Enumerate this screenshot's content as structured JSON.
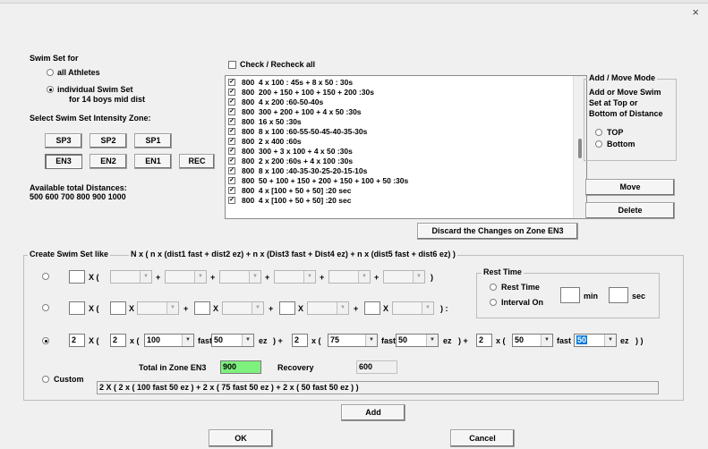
{
  "window": {
    "close_glyph": "×"
  },
  "swim_set_for": {
    "label": "Swim Set for",
    "opt_all": "all Athletes",
    "opt_individual_line1": "individual Swim Set",
    "opt_individual_line2": "for 14 boys mid dist",
    "selected": "individual"
  },
  "intensity": {
    "label": "Select Swim Set Intensity Zone:",
    "buttons": [
      "SP3",
      "SP2",
      "SP1",
      "EN3",
      "EN2",
      "EN1",
      "REC"
    ],
    "selected": "EN3"
  },
  "distances": {
    "label": "Available total Distances:",
    "values": "500 600 700 800 900 1000"
  },
  "check_all": {
    "label": "Check / Recheck all"
  },
  "sets": [
    {
      "dist": "800",
      "desc": "4 x 100 : 45s + 8 x 50 : 30s"
    },
    {
      "dist": "800",
      "desc": "200 + 150 + 100 + 150 + 200 :30s"
    },
    {
      "dist": "800",
      "desc": "4 x 200 :60-50-40s"
    },
    {
      "dist": "800",
      "desc": "300 + 200 + 100 + 4 x 50 :30s"
    },
    {
      "dist": "800",
      "desc": "16 x 50 :30s"
    },
    {
      "dist": "800",
      "desc": "8 x 100 :60-55-50-45-40-35-30s"
    },
    {
      "dist": "800",
      "desc": "2 x 400 :60s"
    },
    {
      "dist": "800",
      "desc": "300 + 3 x 100 + 4 x 50 :30s"
    },
    {
      "dist": "800",
      "desc": "2 x 200 :60s + 4 x 100 :30s"
    },
    {
      "dist": "800",
      "desc": "8 x 100 :40-35-30-25-20-15-10s"
    },
    {
      "dist": "800",
      "desc": "50 + 100 + 150 + 200 + 150 + 100 + 50 :30s"
    },
    {
      "dist": "800",
      "desc": "4 x [100 + 50 + 50] :20 sec"
    },
    {
      "dist": "800",
      "desc": "4 x [100 + 50 + 50] :20 sec"
    }
  ],
  "add_move": {
    "label": "Add / Move Mode",
    "desc_line1": "Add or Move Swim",
    "desc_line2": "Set at Top or",
    "desc_line3": "Bottom of Distance",
    "opt_top": "TOP",
    "opt_bottom": "Bottom"
  },
  "buttons": {
    "move": "Move",
    "delete": "Delete",
    "discard": "Discard the Changes on Zone EN3",
    "add": "Add",
    "ok": "OK",
    "cancel": "Cancel"
  },
  "create": {
    "label": "Create Swim Set like",
    "formula": "N x ( n x (dist1 fast + dist2 ez)  +  n x (Dist3 fast + Dist4 ez)  +  n x (dist5 fast + dist6 ez)  )",
    "row1": {
      "x_open": "X (",
      "plus": "+",
      "close": ")"
    },
    "row2": {
      "x_open": "X (",
      "x": "X",
      "plus": "+",
      "close": ") :"
    },
    "row3": {
      "N": "2",
      "x_open": "X (",
      "n1": "2",
      "d1": "100",
      "fast_label": "fast",
      "e1": "50",
      "ez_label": "ez",
      "n2": "2",
      "d2": "75",
      "e2": "50",
      "n3": "2",
      "d3": "50",
      "e3": "50",
      "times": "x (",
      "close_inner": ") +",
      "close_last": ") )"
    },
    "custom_label": "Custom",
    "total_label": "Total in Zone EN3",
    "total_value": "900",
    "recovery_label": "Recovery",
    "recovery_value": "600",
    "summary": "2 X ( 2 x ( 100 fast 50 ez ) + 2 x ( 75 fast 50 ez ) + 2 x ( 50 fast 50 ez ) )"
  },
  "rest_time": {
    "label": "Rest Time",
    "opt_rest": "Rest Time",
    "opt_interval": "Interval On",
    "min_label": "min",
    "sec_label": "sec"
  }
}
